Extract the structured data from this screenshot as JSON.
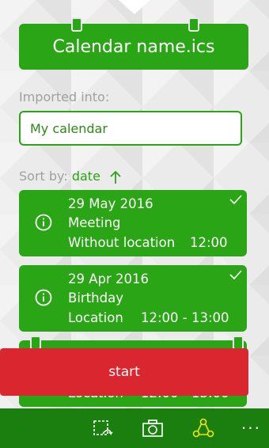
{
  "header": {
    "title": "Calendar name.ics"
  },
  "import": {
    "label": "Imported into:",
    "calendar": "My calendar"
  },
  "sort": {
    "label": "Sort by:",
    "value": "date"
  },
  "events": [
    {
      "date": "29 May 2016",
      "title": "Meeting",
      "location": "Without location",
      "time": "12:00",
      "checked": true
    },
    {
      "date": "29 Apr 2016",
      "title": "Birthday",
      "location": "Location",
      "time": "12:00 - 13:00",
      "checked": true
    },
    {
      "location": "Location",
      "time": "12:00 - 13:00"
    }
  ],
  "start_button": {
    "label": "start"
  },
  "appbar": {
    "icons": [
      "select-icon",
      "camera-icon",
      "share-icon",
      "more-icon"
    ],
    "more": "···"
  },
  "colors": {
    "accent": "#2aa515",
    "start": "#d9262f",
    "appbar": "#1b7f10"
  }
}
